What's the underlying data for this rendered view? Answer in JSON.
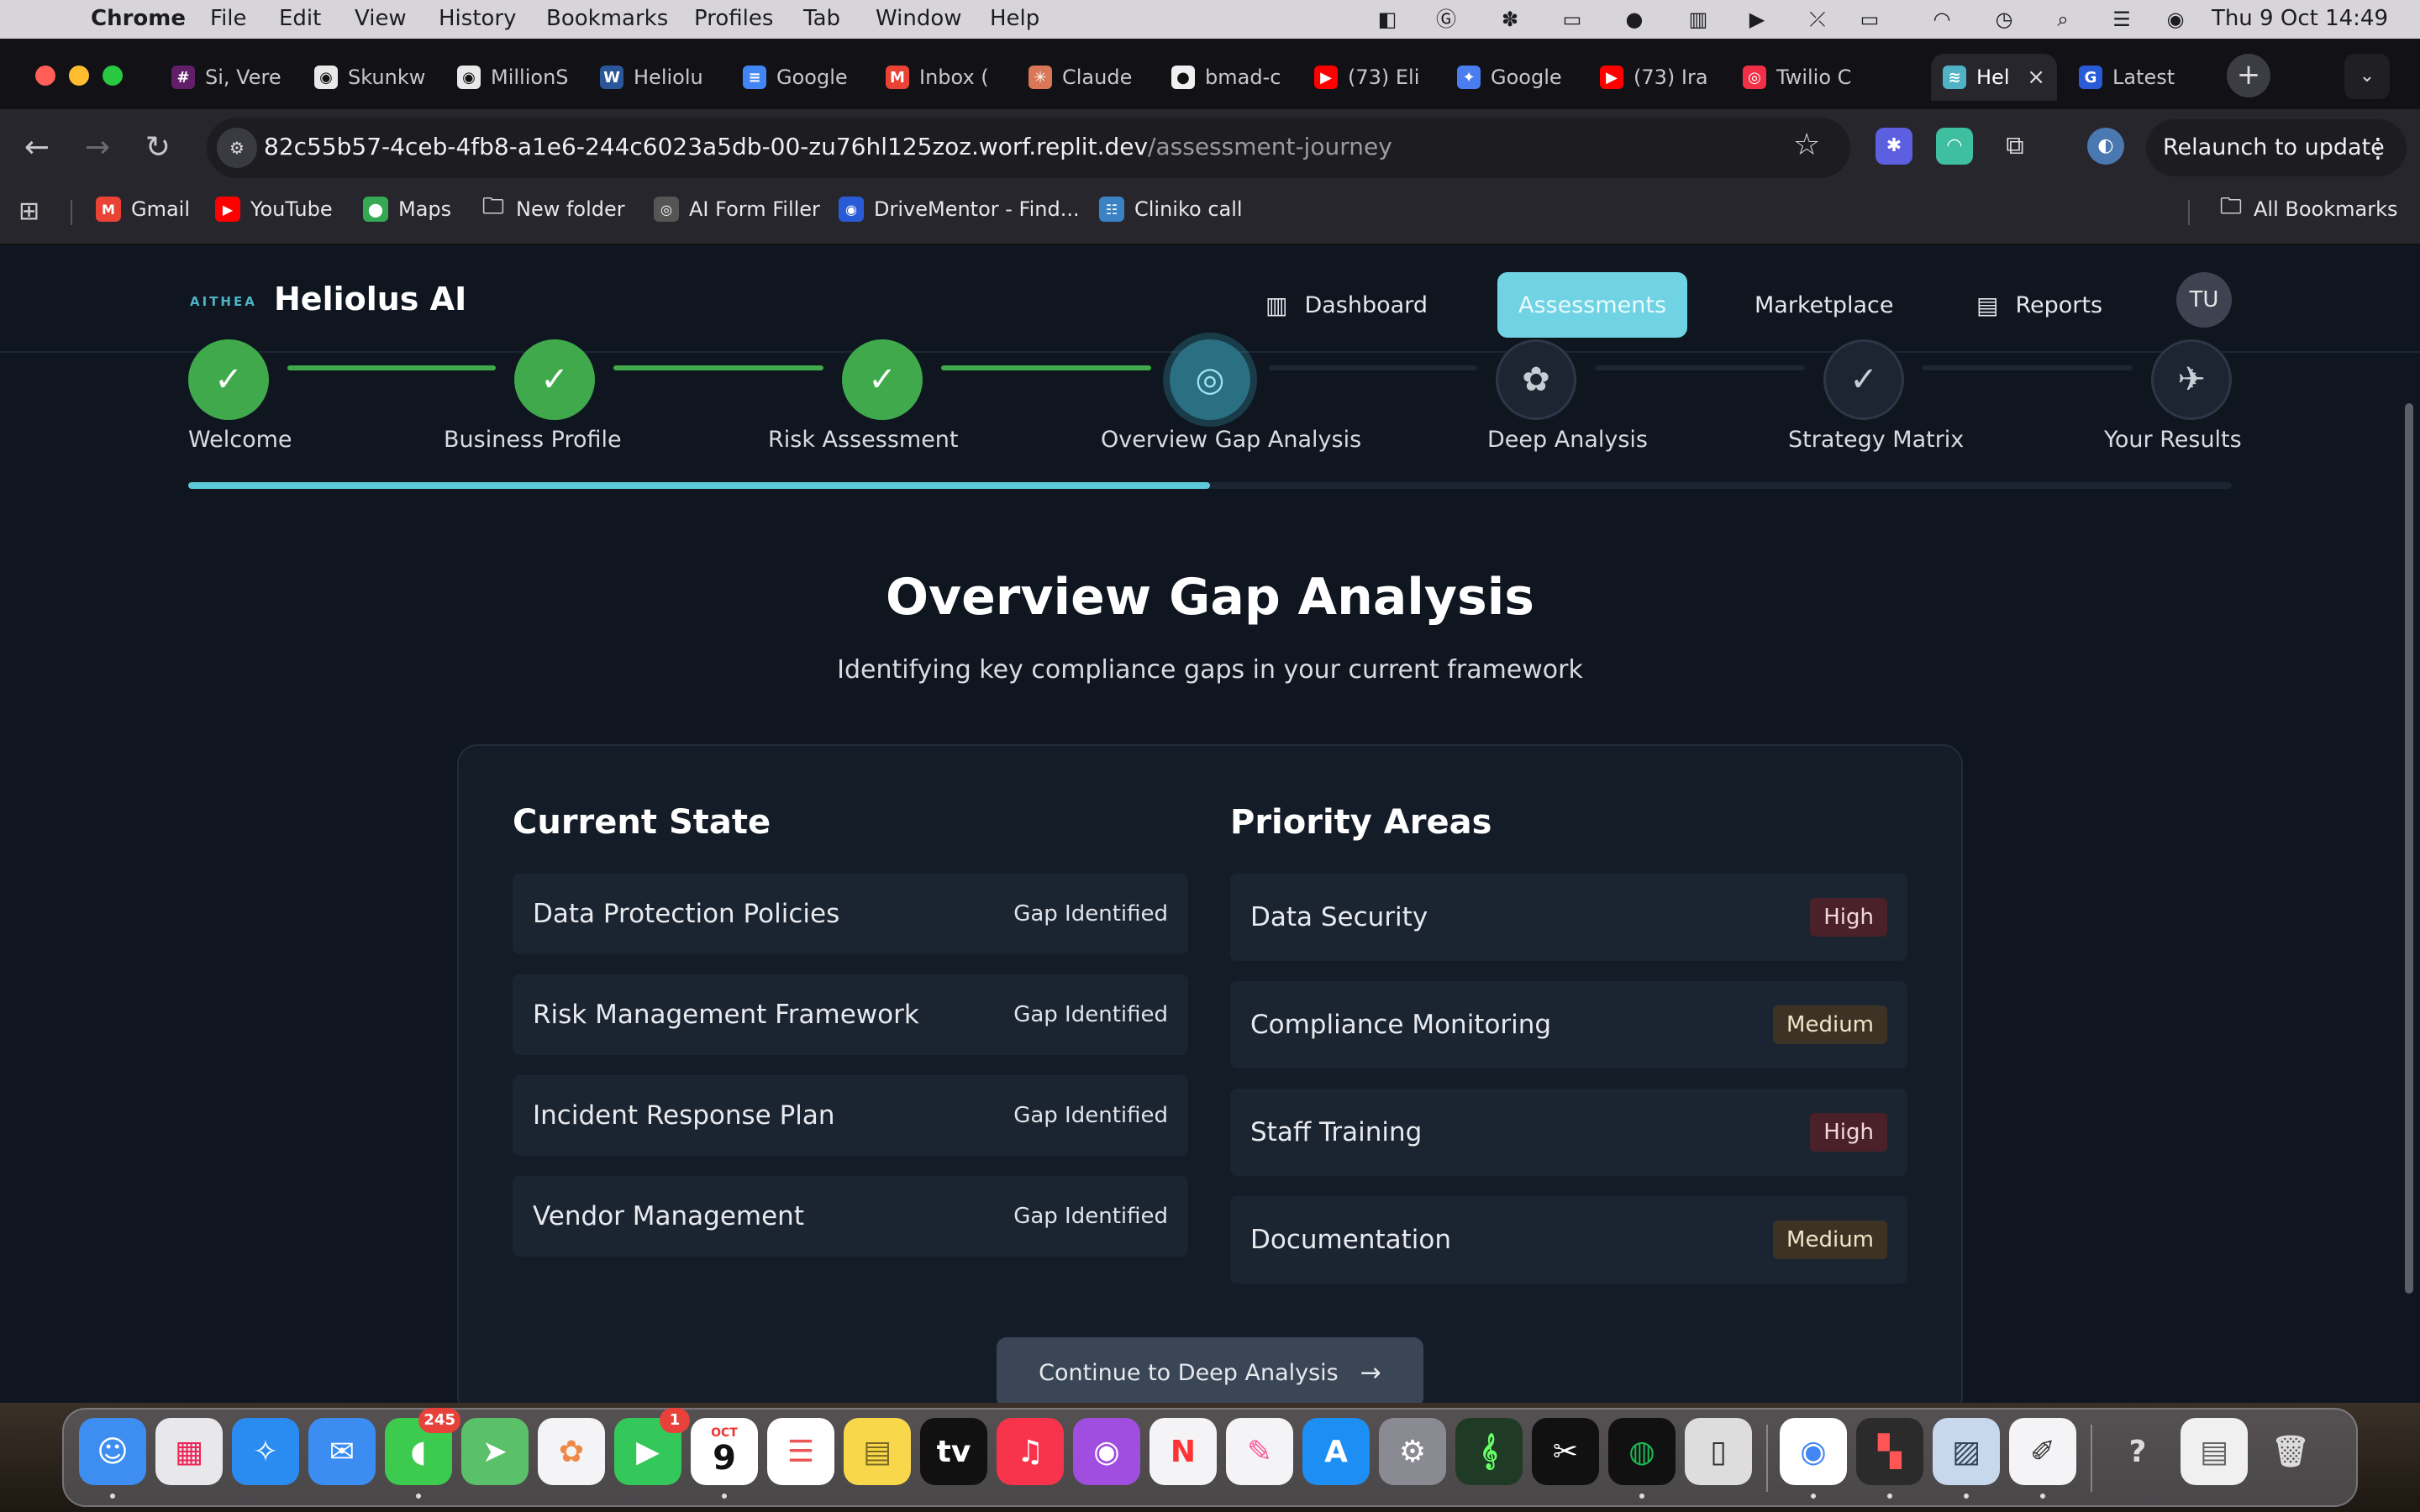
{
  "menubar": {
    "app_name": "Chrome",
    "menus": [
      "File",
      "Edit",
      "View",
      "History",
      "Bookmarks",
      "Profiles",
      "Tab",
      "Window",
      "Help"
    ],
    "clock": "Thu 9 Oct  14:49"
  },
  "tabs": [
    {
      "label": "Si, Vere",
      "color": "#611f69",
      "glyph": "#"
    },
    {
      "label": "Skunkw",
      "color": "#e8e8e8",
      "glyph": "◉"
    },
    {
      "label": "MillionS",
      "color": "#e8e8e8",
      "glyph": "◉"
    },
    {
      "label": "Heliolu",
      "color": "#2b579a",
      "glyph": "W"
    },
    {
      "label": "Google",
      "color": "#4285f4",
      "glyph": "≡"
    },
    {
      "label": "Inbox (",
      "color": "#ea4335",
      "glyph": "M"
    },
    {
      "label": "Claude",
      "color": "#d97757",
      "glyph": "✳"
    },
    {
      "label": "bmad-c",
      "color": "#f0f0f0",
      "glyph": "●"
    },
    {
      "label": "(73) Eli",
      "color": "#ff0000",
      "glyph": "▶"
    },
    {
      "label": "Google",
      "color": "#4a7ef0",
      "glyph": "✦"
    },
    {
      "label": "(73) Ira",
      "color": "#ff0000",
      "glyph": "▶"
    },
    {
      "label": "Twilio C",
      "color": "#f22f46",
      "glyph": "◎"
    },
    {
      "label": "Hel",
      "color": "#4fb3c5",
      "glyph": "≋"
    },
    {
      "label": "Latest",
      "color": "#2a5bd7",
      "glyph": "G"
    }
  ],
  "omnibox": {
    "host": "82c55b57-4ceb-4fb8-a1e6-244c6023a5db-00-zu76hl125zoz.worf.replit.dev",
    "path": "/assessment-journey"
  },
  "relaunch_label": "Relaunch to update",
  "bookmarks": [
    {
      "label": "Gmail",
      "color": "#ea4335",
      "glyph": "M"
    },
    {
      "label": "YouTube",
      "color": "#ff0000",
      "glyph": "▶"
    },
    {
      "label": "Maps",
      "color": "#34a853",
      "glyph": "⬤"
    },
    {
      "label": "New folder",
      "color": "transparent",
      "glyph": "🗀"
    },
    {
      "label": "AI Form Filler",
      "color": "#555",
      "glyph": "◎"
    },
    {
      "label": "DriveMentor - Find...",
      "color": "#2a5bd7",
      "glyph": "◉"
    },
    {
      "label": "Cliniko call",
      "color": "#3b82c4",
      "glyph": "☷"
    }
  ],
  "all_bookmarks": "All Bookmarks",
  "app": {
    "logo_mark": "AITHEA",
    "name": "Heliolus AI",
    "nav": {
      "dashboard": "Dashboard",
      "assessments": "Assessments",
      "marketplace": "Marketplace",
      "reports": "Reports"
    },
    "avatar": "TU"
  },
  "steps": [
    {
      "label": "Welcome",
      "state": "done"
    },
    {
      "label": "Business Profile",
      "state": "done"
    },
    {
      "label": "Risk Assessment",
      "state": "done"
    },
    {
      "label": "Overview Gap Analysis",
      "state": "current"
    },
    {
      "label": "Deep Analysis",
      "state": "todo"
    },
    {
      "label": "Strategy Matrix",
      "state": "todo"
    },
    {
      "label": "Your Results",
      "state": "todo"
    }
  ],
  "progress_fraction": 0.5,
  "main": {
    "title": "Overview Gap Analysis",
    "subtitle": "Identifying key compliance gaps in your current framework"
  },
  "current_state": {
    "title": "Current State",
    "items": [
      {
        "name": "Data Protection Policies",
        "status": "Gap Identified"
      },
      {
        "name": "Risk Management Framework",
        "status": "Gap Identified"
      },
      {
        "name": "Incident Response Plan",
        "status": "Gap Identified"
      },
      {
        "name": "Vendor Management",
        "status": "Gap Identified"
      }
    ]
  },
  "priority_areas": {
    "title": "Priority Areas",
    "items": [
      {
        "name": "Data Security",
        "priority": "High"
      },
      {
        "name": "Compliance Monitoring",
        "priority": "Medium"
      },
      {
        "name": "Staff Training",
        "priority": "High"
      },
      {
        "name": "Documentation",
        "priority": "Medium"
      }
    ]
  },
  "continue_label": "Continue to Deep Analysis",
  "dock": {
    "messages_badge": "245",
    "facetime_badge": "1",
    "calendar_month": "OCT",
    "calendar_day": "9"
  }
}
